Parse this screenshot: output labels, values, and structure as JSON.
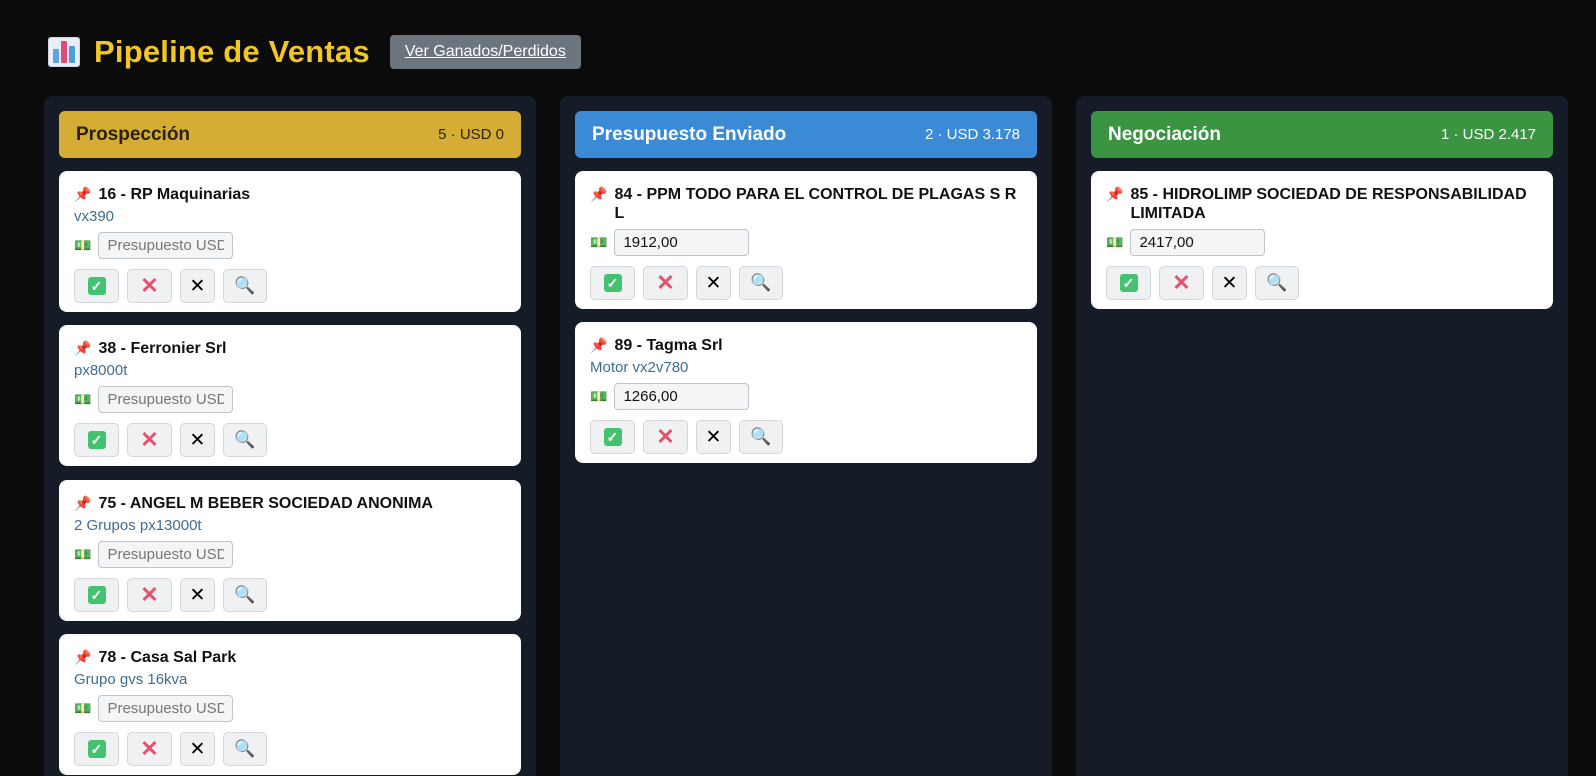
{
  "header": {
    "title": "Pipeline de Ventas",
    "icon": "bar-chart-icon",
    "toggle_label": "Ver Ganados/Perdidos"
  },
  "labels": {
    "budget_placeholder": "Presupuesto USD"
  },
  "colors": {
    "prospeccion": "#d5ad35",
    "presupuesto": "#3a8ad6",
    "negociacion": "#3a9442",
    "client_text": "#3f6c94"
  },
  "columns": [
    {
      "title": "Prospección",
      "summary": "5 · USD 0",
      "cards": [
        {
          "title": "16 - RP Maquinarias",
          "subtitle": "vx390",
          "budget": ""
        },
        {
          "title": "38 - Ferronier Srl",
          "subtitle": "px8000t",
          "budget": ""
        },
        {
          "title": "75 - ANGEL M BEBER SOCIEDAD ANONIMA",
          "subtitle": "2 Grupos px13000t",
          "budget": ""
        },
        {
          "title": "78 - Casa Sal Park",
          "subtitle": "Grupo gvs 16kva",
          "budget": ""
        }
      ]
    },
    {
      "title": "Presupuesto Enviado",
      "summary": "2 · USD 3.178",
      "cards": [
        {
          "title": "84 - PPM TODO PARA EL CONTROL DE PLAGAS S R L",
          "subtitle": "",
          "budget": "1912,00"
        },
        {
          "title": "89 - Tagma Srl",
          "subtitle": "Motor vx2v780",
          "budget": "1266,00"
        }
      ]
    },
    {
      "title": "Negociación",
      "summary": "1 · USD 2.417",
      "cards": [
        {
          "title": "85 - HIDROLIMP SOCIEDAD DE RESPONSABILIDAD LIMITADA",
          "subtitle": "",
          "budget": "2417,00"
        }
      ]
    }
  ]
}
